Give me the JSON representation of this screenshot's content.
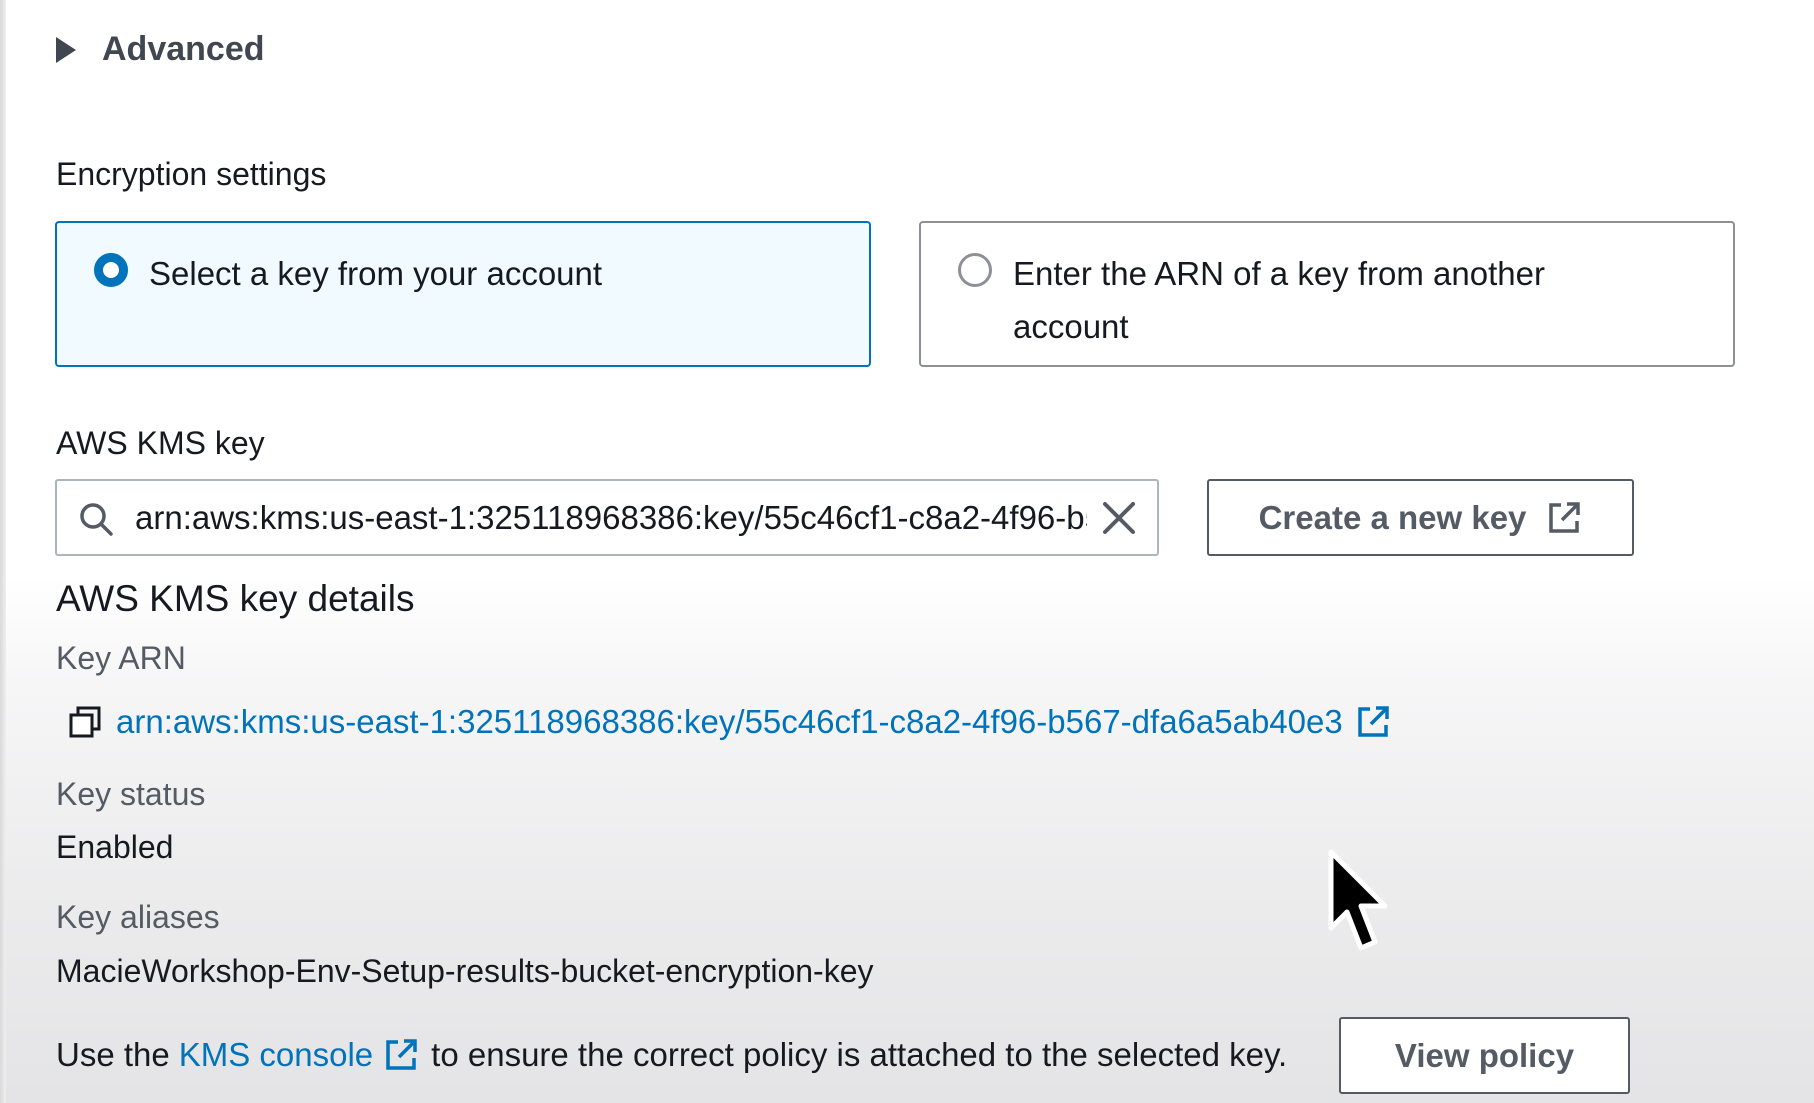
{
  "advanced": {
    "label": "Advanced"
  },
  "encryption": {
    "heading": "Encryption settings",
    "options": [
      {
        "label": "Select a key from your account",
        "selected": true
      },
      {
        "label": "Enter the ARN of a key from another account",
        "selected": false
      }
    ]
  },
  "kms_key": {
    "label": "AWS KMS key",
    "search_value": "arn:aws:kms:us-east-1:325118968386:key/55c46cf1-c8a2-4f96-b567-dfa6a5ab40e3",
    "create_button": "Create a new key"
  },
  "key_details": {
    "title": "AWS KMS key details",
    "arn_label": "Key ARN",
    "arn_value": "arn:aws:kms:us-east-1:325118968386:key/55c46cf1-c8a2-4f96-b567-dfa6a5ab40e3",
    "status_label": "Key status",
    "status_value": "Enabled",
    "aliases_label": "Key aliases",
    "aliases_value": "MacieWorkshop-Env-Setup-results-bucket-encryption-key"
  },
  "policy_note": {
    "prefix": "Use the",
    "link": "KMS console",
    "suffix": "to ensure the correct policy is attached to the selected key.",
    "view_button": "View policy"
  },
  "colors": {
    "accent": "#0073bb",
    "selected_tile_bg": "#f1faff",
    "text": "#16191f",
    "secondary_text": "#545b64"
  },
  "icons": [
    "caret-right-icon",
    "search-icon",
    "clear-icon",
    "external-link-icon",
    "copy-icon",
    "mouse-pointer-icon"
  ]
}
